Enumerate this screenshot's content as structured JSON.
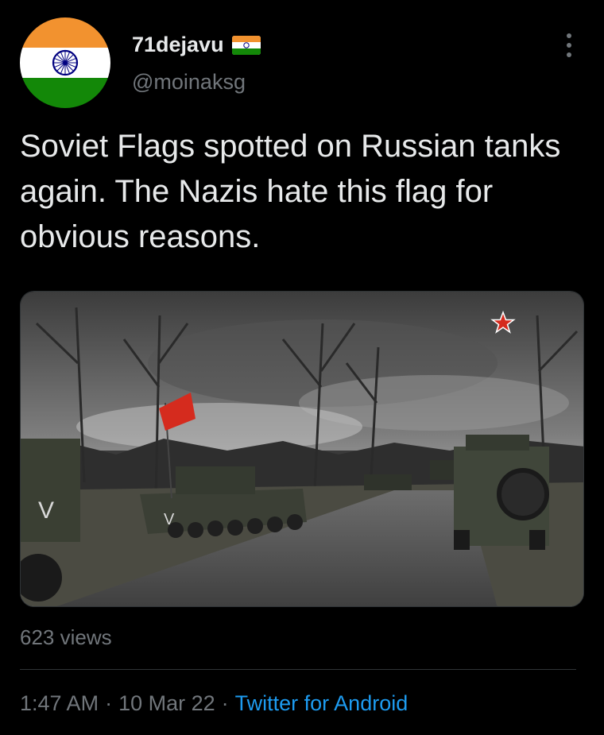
{
  "author": {
    "display_name": "71dejavu",
    "handle": "@moinaksg",
    "avatar_icon": "india-flag-icon",
    "name_badge_icon": "india-flag-icon"
  },
  "tweet": {
    "text": "Soviet Flags spotted on Russian tanks again. The Nazis hate this flag for obvious reasons.",
    "media_alt_icons": [
      "zvezda-star-logo-icon",
      "soviet-flag"
    ],
    "views": "623 views",
    "time": "1:47 AM",
    "date": "10 Mar 22",
    "separator": "·",
    "source": "Twitter for Android"
  },
  "colors": {
    "background": "#000000",
    "text_primary": "#e7e9ea",
    "text_secondary": "#71767b",
    "link": "#1d9bf0",
    "saffron": "#f2922f",
    "green": "#138808",
    "chakra": "#000080",
    "soviet_red": "#d52b1e"
  }
}
